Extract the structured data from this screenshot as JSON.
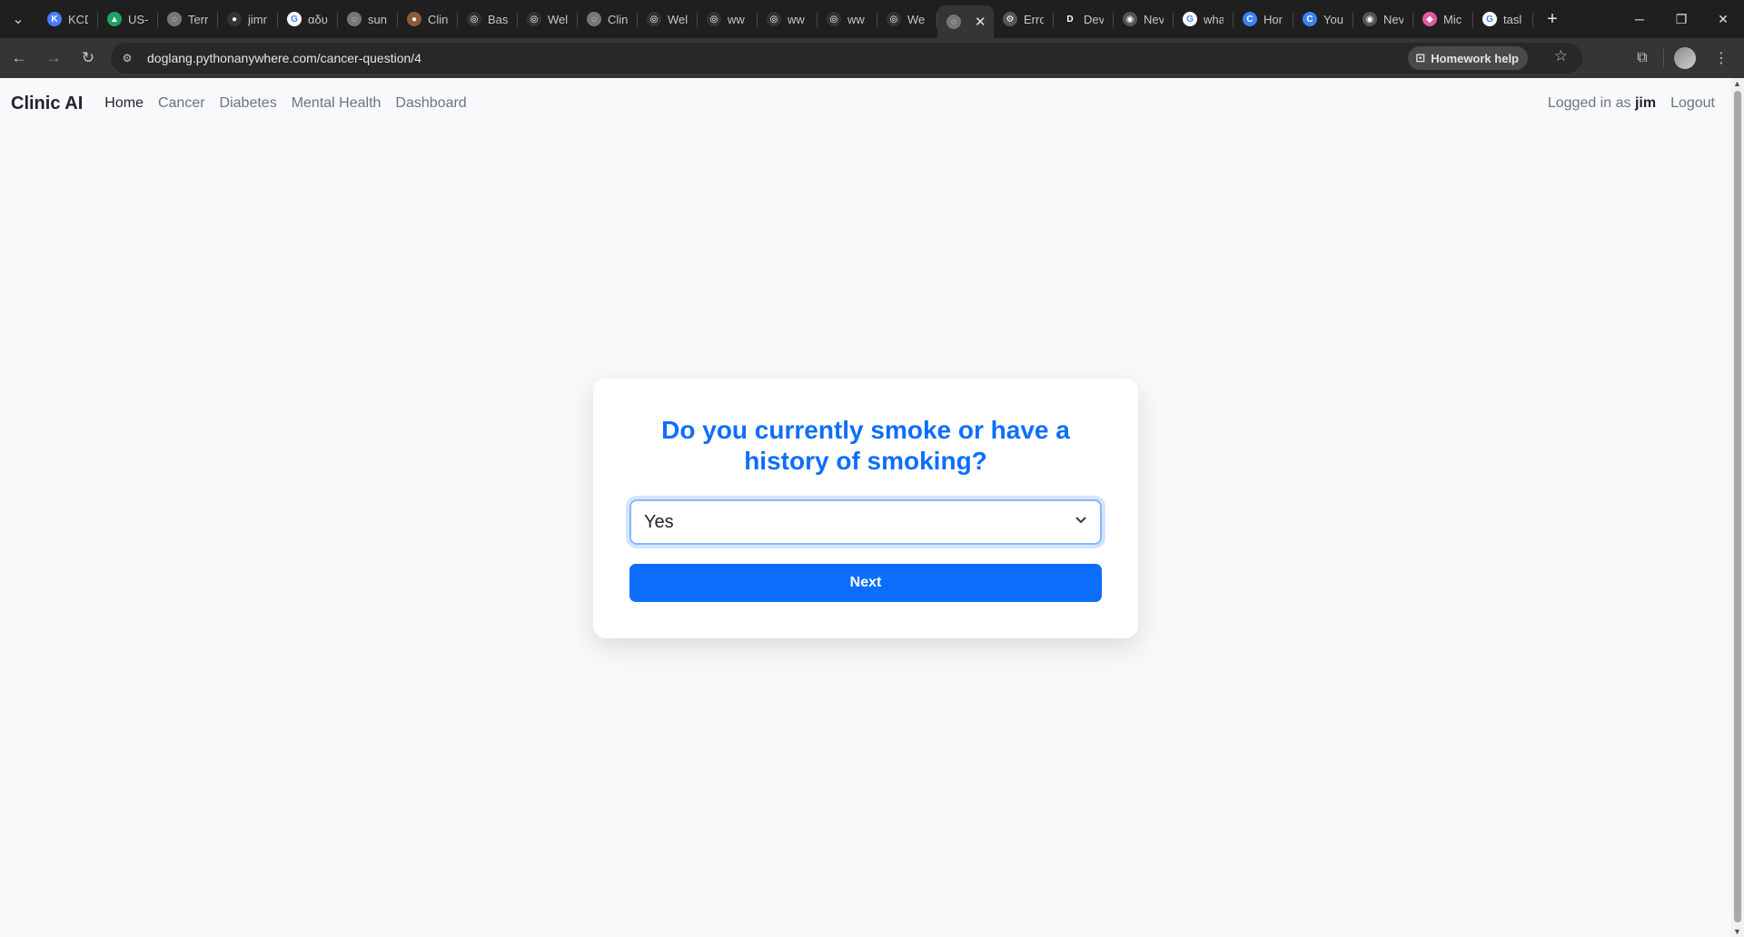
{
  "browser": {
    "tabs": [
      {
        "title": "KCD",
        "color": "#4a7cff",
        "icon": "K"
      },
      {
        "title": "US-",
        "color": "#1ea362",
        "icon": "▲"
      },
      {
        "title": "Terr",
        "color": "#777777",
        "icon": "◌"
      },
      {
        "title": "jimr",
        "color": "#333333",
        "icon": "●"
      },
      {
        "title": "αδυ",
        "color": "#ffffff",
        "icon": "G"
      },
      {
        "title": "sun",
        "color": "#777777",
        "icon": "◌"
      },
      {
        "title": "Clin",
        "color": "#8d5a3b",
        "icon": "●"
      },
      {
        "title": "Basi",
        "color": "#333333",
        "icon": "◎"
      },
      {
        "title": "Wel",
        "color": "#333333",
        "icon": "◎"
      },
      {
        "title": "Clin",
        "color": "#777777",
        "icon": "◌"
      },
      {
        "title": "Wel",
        "color": "#333333",
        "icon": "◎"
      },
      {
        "title": "ww",
        "color": "#333333",
        "icon": "◎"
      },
      {
        "title": "ww",
        "color": "#333333",
        "icon": "◎"
      },
      {
        "title": "ww",
        "color": "#333333",
        "icon": "◎"
      },
      {
        "title": "We",
        "color": "#333333",
        "icon": "◎"
      },
      {
        "title": "",
        "color": "#777777",
        "icon": "◌",
        "active": true
      },
      {
        "title": "Erro",
        "color": "#555555",
        "icon": "⚙"
      },
      {
        "title": "Dev",
        "color": "#1f1f1f",
        "icon": "D"
      },
      {
        "title": "Nev",
        "color": "#555555",
        "icon": "◉"
      },
      {
        "title": "wha",
        "color": "#ffffff",
        "icon": "G"
      },
      {
        "title": "Hor",
        "color": "#3b82f6",
        "icon": "C"
      },
      {
        "title": "You",
        "color": "#3b82f6",
        "icon": "C"
      },
      {
        "title": "Nev",
        "color": "#555555",
        "icon": "◉"
      },
      {
        "title": "Mic",
        "color": "#e05aa0",
        "icon": "◆"
      },
      {
        "title": "tasl",
        "color": "#ffffff",
        "icon": "G"
      }
    ],
    "url": "doglang.pythonanywhere.com/cancer-question/4",
    "homework_help": "Homework help"
  },
  "nav": {
    "brand": "Clinic AI",
    "links": [
      "Home",
      "Cancer",
      "Diabetes",
      "Mental Health",
      "Dashboard"
    ],
    "logged_in_prefix": "Logged in as",
    "username": "jim",
    "logout": "Logout"
  },
  "question": {
    "text": "Do you currently smoke or have a history of smoking?",
    "selected_value": "Yes",
    "next_label": "Next"
  }
}
